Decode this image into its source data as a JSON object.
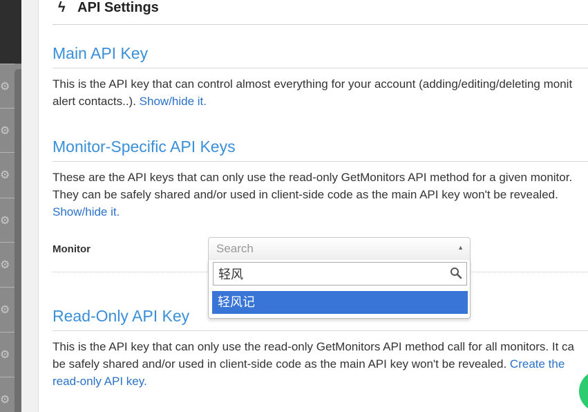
{
  "panel": {
    "title": "API Settings",
    "title_icon": "bolt-icon"
  },
  "main_key": {
    "heading": "Main API Key",
    "text_line1": "This is the API key that can control almost everything for your account (adding/editing/deleting monit",
    "text_line2": "alert contacts..). ",
    "link": "Show/hide it."
  },
  "monitor_keys": {
    "heading": "Monitor-Specific API Keys",
    "text_line1": "These are the API keys that can only use the read-only GetMonitors API method for a given monitor.",
    "text_line2": "They can be safely shared and/or used in client-side code as the main API key won't be revealed.",
    "link": "Show/hide it."
  },
  "monitor_field": {
    "label": "Monitor",
    "placeholder": "Search",
    "search_value": "轻风",
    "results": [
      "轻风记"
    ]
  },
  "readonly_key": {
    "heading": "Read-Only API Key",
    "text_line1": "This is the API key that can only use the read-only GetMonitors API method call for all monitors. It ca",
    "text_line2_a": "be safely shared and/or used in client-side code as the main API key won't be revealed. ",
    "link_part1": "Create the",
    "link_part2": "read-only API key."
  },
  "sidebar": {
    "icon": "gear-icon",
    "item_count_visible": 8
  },
  "colors": {
    "heading": "#3a8fd9",
    "link": "#2a72c9",
    "highlight": "#3875d7"
  }
}
